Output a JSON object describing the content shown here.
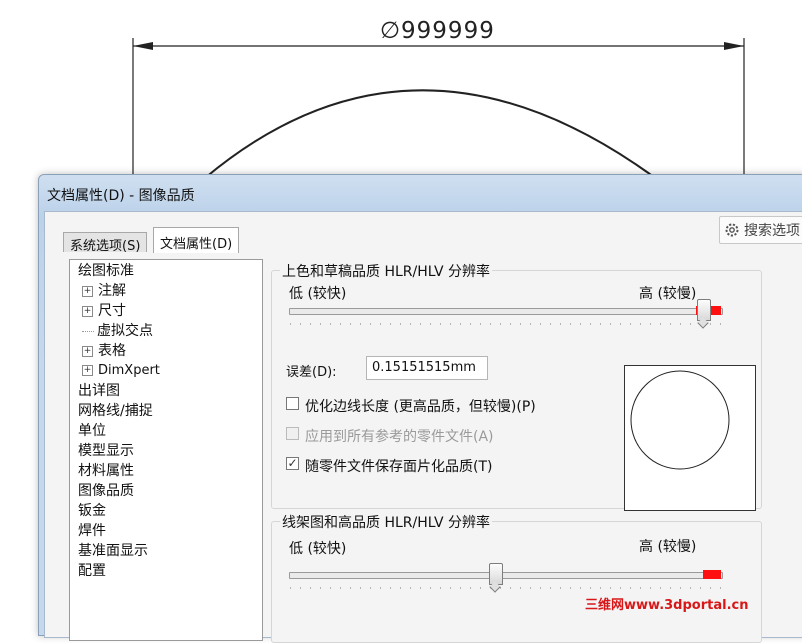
{
  "drawing": {
    "dimension_text": "∅999999"
  },
  "dialog": {
    "title": "文档属性(D) - 图像品质",
    "search": {
      "label": "搜索选项",
      "icon": "gear-icon"
    },
    "tabs": [
      {
        "label": "系统选项(S)",
        "selected": false
      },
      {
        "label": "文档属性(D)",
        "selected": true
      }
    ],
    "tree": [
      {
        "label": "绘图标准",
        "expand": ""
      },
      {
        "label": "注解",
        "expand": "+"
      },
      {
        "label": "尺寸",
        "expand": "+"
      },
      {
        "label": "虚拟交点",
        "expand": "dots"
      },
      {
        "label": "表格",
        "expand": "+"
      },
      {
        "label": "DimXpert",
        "expand": "+"
      },
      {
        "label": "出详图",
        "expand": ""
      },
      {
        "label": "网格线/捕捉",
        "expand": ""
      },
      {
        "label": "单位",
        "expand": ""
      },
      {
        "label": "模型显示",
        "expand": ""
      },
      {
        "label": "材料属性",
        "expand": ""
      },
      {
        "label": "图像品质",
        "expand": "",
        "selected": true
      },
      {
        "label": "钣金",
        "expand": ""
      },
      {
        "label": "焊件",
        "expand": ""
      },
      {
        "label": "基准面显示",
        "expand": ""
      },
      {
        "label": "配置",
        "expand": ""
      }
    ],
    "shaded": {
      "title": "上色和草稿品质 HLR/HLV 分辨率",
      "low": "低 (较快)",
      "high": "高 (较慢)",
      "slider_value": 0.96,
      "deviation_label": "误差(D):",
      "deviation_value": "0.15151515mm",
      "opt_edge": {
        "label": "优化边线长度 (更高品质，但较慢)(P)",
        "checked": false
      },
      "apply_all": {
        "label": "应用到所有参考的零件文件(A)",
        "checked": false,
        "disabled": true
      },
      "save_with_part": {
        "label": "随零件文件保存面片化品质(T)",
        "checked": true
      }
    },
    "wireframe": {
      "title": "线架图和高品质 HLR/HLV 分辨率",
      "low": "低 (较快)",
      "high": "高 (较慢)",
      "slider_value": 0.48
    }
  },
  "watermark": "三维网www.3dportal.cn"
}
